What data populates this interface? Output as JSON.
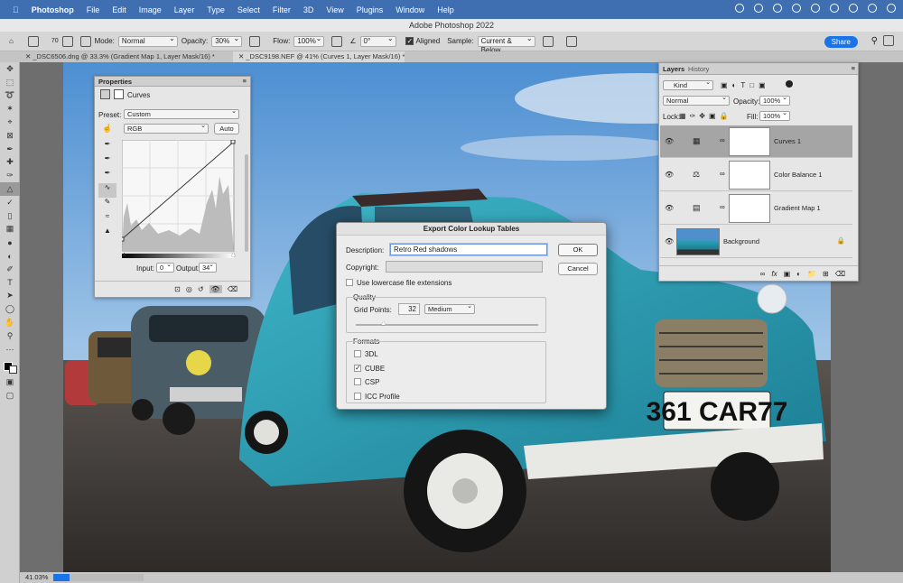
{
  "menubar": {
    "app": "Photoshop",
    "items": [
      "File",
      "Edit",
      "Image",
      "Layer",
      "Type",
      "Select",
      "Filter",
      "3D",
      "View",
      "Plugins",
      "Window",
      "Help"
    ]
  },
  "window": {
    "title": "Adobe Photoshop 2022"
  },
  "options": {
    "brush_size": "70",
    "mode_label": "Mode:",
    "mode": "Normal",
    "opacity_label": "Opacity:",
    "opacity": "30%",
    "flow_label": "Flow:",
    "flow": "100%",
    "angle": "0°",
    "aligned_label": "Aligned",
    "sample_label": "Sample:",
    "sample": "Current & Below",
    "share": "Share"
  },
  "doc_tabs": [
    {
      "label": "_DSC6506.dng @ 33.3% (Gradient Map 1, Layer Mask/16) *"
    },
    {
      "label": "_DSC9198.NEF @ 41% (Curves 1, Layer Mask/16) *"
    }
  ],
  "properties": {
    "tab": "Properties",
    "type": "Curves",
    "preset_label": "Preset:",
    "preset": "Custom",
    "channel": "RGB",
    "auto": "Auto",
    "input_label": "Input:",
    "input": "0",
    "output_label": "Output:",
    "output": "34"
  },
  "layers": {
    "tabs": [
      "Layers",
      "History"
    ],
    "filter": "Kind",
    "blend": "Normal",
    "opacity_label": "Opacity:",
    "opacity": "100%",
    "lock_label": "Lock:",
    "fill_label": "Fill:",
    "fill": "100%",
    "rows": [
      {
        "name": "Curves 1",
        "selected": true
      },
      {
        "name": "Color Balance 1",
        "selected": false
      },
      {
        "name": "Gradient Map 1",
        "selected": false
      },
      {
        "name": "Background",
        "selected": false
      }
    ]
  },
  "dialog": {
    "title": "Export Color Lookup Tables",
    "description_label": "Description:",
    "description": "Retro Red shadows",
    "copyright_label": "Copyright:",
    "copyright": "",
    "ok": "OK",
    "cancel": "Cancel",
    "lowercase_label": "Use lowercase file extensions",
    "lowercase": false,
    "quality_label": "Quality",
    "grid_points_label": "Grid Points:",
    "grid_points": "32",
    "quality": "Medium",
    "grid_slider": 0.15,
    "formats_label": "Formats",
    "formats": [
      {
        "name": "3DL",
        "checked": false
      },
      {
        "name": "CUBE",
        "checked": true
      },
      {
        "name": "CSP",
        "checked": false
      },
      {
        "name": "ICC Profile",
        "checked": false
      }
    ]
  },
  "status": {
    "zoom": "41.03%",
    "progress": 0.18
  },
  "canvas": {
    "plate": "361 CAR77"
  },
  "colors": {
    "accent": "#1a73e8",
    "car": "#2aa3b8"
  }
}
